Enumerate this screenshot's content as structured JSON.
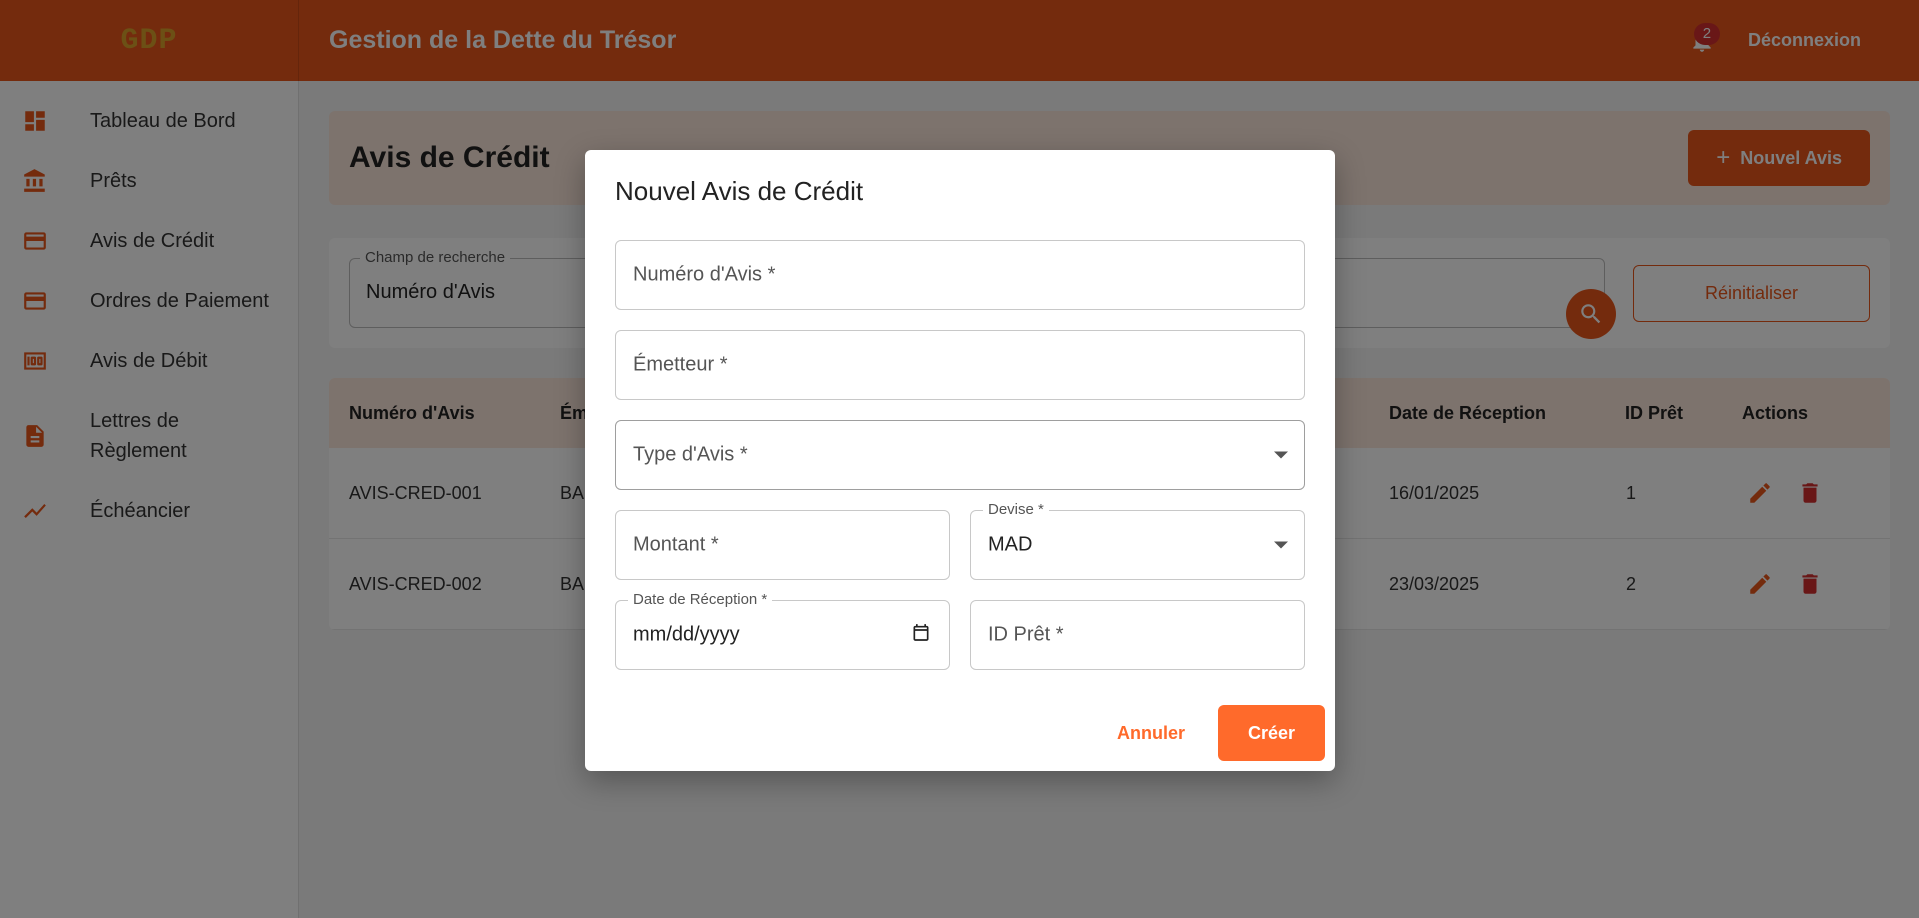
{
  "header": {
    "logo": "GDP",
    "title": "Gestion de la Dette du Trésor",
    "notification_count": "2",
    "logout_label": "Déconnexion"
  },
  "sidebar": {
    "items": [
      {
        "label": "Tableau de Bord",
        "icon": "dashboard-icon"
      },
      {
        "label": "Prêts",
        "icon": "bank-icon"
      },
      {
        "label": "Avis de Crédit",
        "icon": "credit-card-icon"
      },
      {
        "label": "Ordres de Paiement",
        "icon": "credit-card-icon"
      },
      {
        "label": "Avis de Débit",
        "icon": "money-icon"
      },
      {
        "label": "Lettres de Règlement",
        "icon": "document-icon"
      },
      {
        "label": "Échéancier",
        "icon": "trend-icon"
      }
    ]
  },
  "page": {
    "title": "Avis de Crédit",
    "new_button_label": "Nouvel Avis"
  },
  "search": {
    "legend": "Champ de recherche",
    "value": "Numéro d'Avis",
    "reset_label": "Réinitialiser"
  },
  "table": {
    "columns": [
      "Numéro d'Avis",
      "Ém",
      "Date de Réception",
      "ID Prêt",
      "Actions"
    ],
    "rows": [
      {
        "numero": "AVIS-CRED-001",
        "emetteur": "BA",
        "date": "16/01/2025",
        "id_pret": "1"
      },
      {
        "numero": "AVIS-CRED-002",
        "emetteur": "BA",
        "date": "23/03/2025",
        "id_pret": "2"
      }
    ]
  },
  "dialog": {
    "title": "Nouvel Avis de Crédit",
    "fields": {
      "numero": {
        "placeholder": "Numéro d'Avis *"
      },
      "emetteur": {
        "placeholder": "Émetteur *"
      },
      "type": {
        "placeholder": "Type d'Avis *"
      },
      "montant": {
        "placeholder": "Montant *"
      },
      "devise": {
        "legend": "Devise *",
        "value": "MAD"
      },
      "date": {
        "legend": "Date de Réception *",
        "value": "mm/dd/yyyy"
      },
      "id_pret": {
        "placeholder": "ID Prêt *"
      }
    },
    "cancel_label": "Annuler",
    "create_label": "Créer"
  },
  "colors": {
    "accent": "#e8561b",
    "accent_light": "#fbe6da",
    "button_orange": "#ff6a2b",
    "danger": "#d32f2f"
  }
}
